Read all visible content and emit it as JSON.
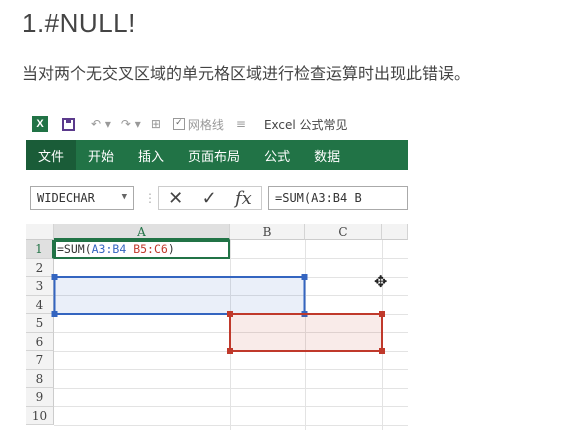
{
  "article": {
    "heading": "1.#NULL!",
    "description": "当对两个无交叉区域的单元格区域进行检查运算时出现此错误。"
  },
  "excel": {
    "titlebar": {
      "gridlines_label": "网格线",
      "window_title": "Excel 公式常见"
    },
    "ribbon_tabs": [
      "文件",
      "开始",
      "插入",
      "页面布局",
      "公式",
      "数据"
    ],
    "name_box": "WIDECHAR",
    "formula_bar_text": "=SUM(A3:B4 B",
    "columns": [
      "A",
      "B",
      "C"
    ],
    "rows": [
      "1",
      "2",
      "3",
      "4",
      "5",
      "6",
      "7",
      "8",
      "9",
      "10"
    ],
    "cell_A1": {
      "prefix": "=SUM(",
      "ref1": "A3:B4",
      "space": " ",
      "ref2": "B5:C6",
      "suffix": ")"
    },
    "colors": {
      "excel_green": "#217346",
      "range1": "#3465c0",
      "range2": "#c0392b"
    }
  }
}
